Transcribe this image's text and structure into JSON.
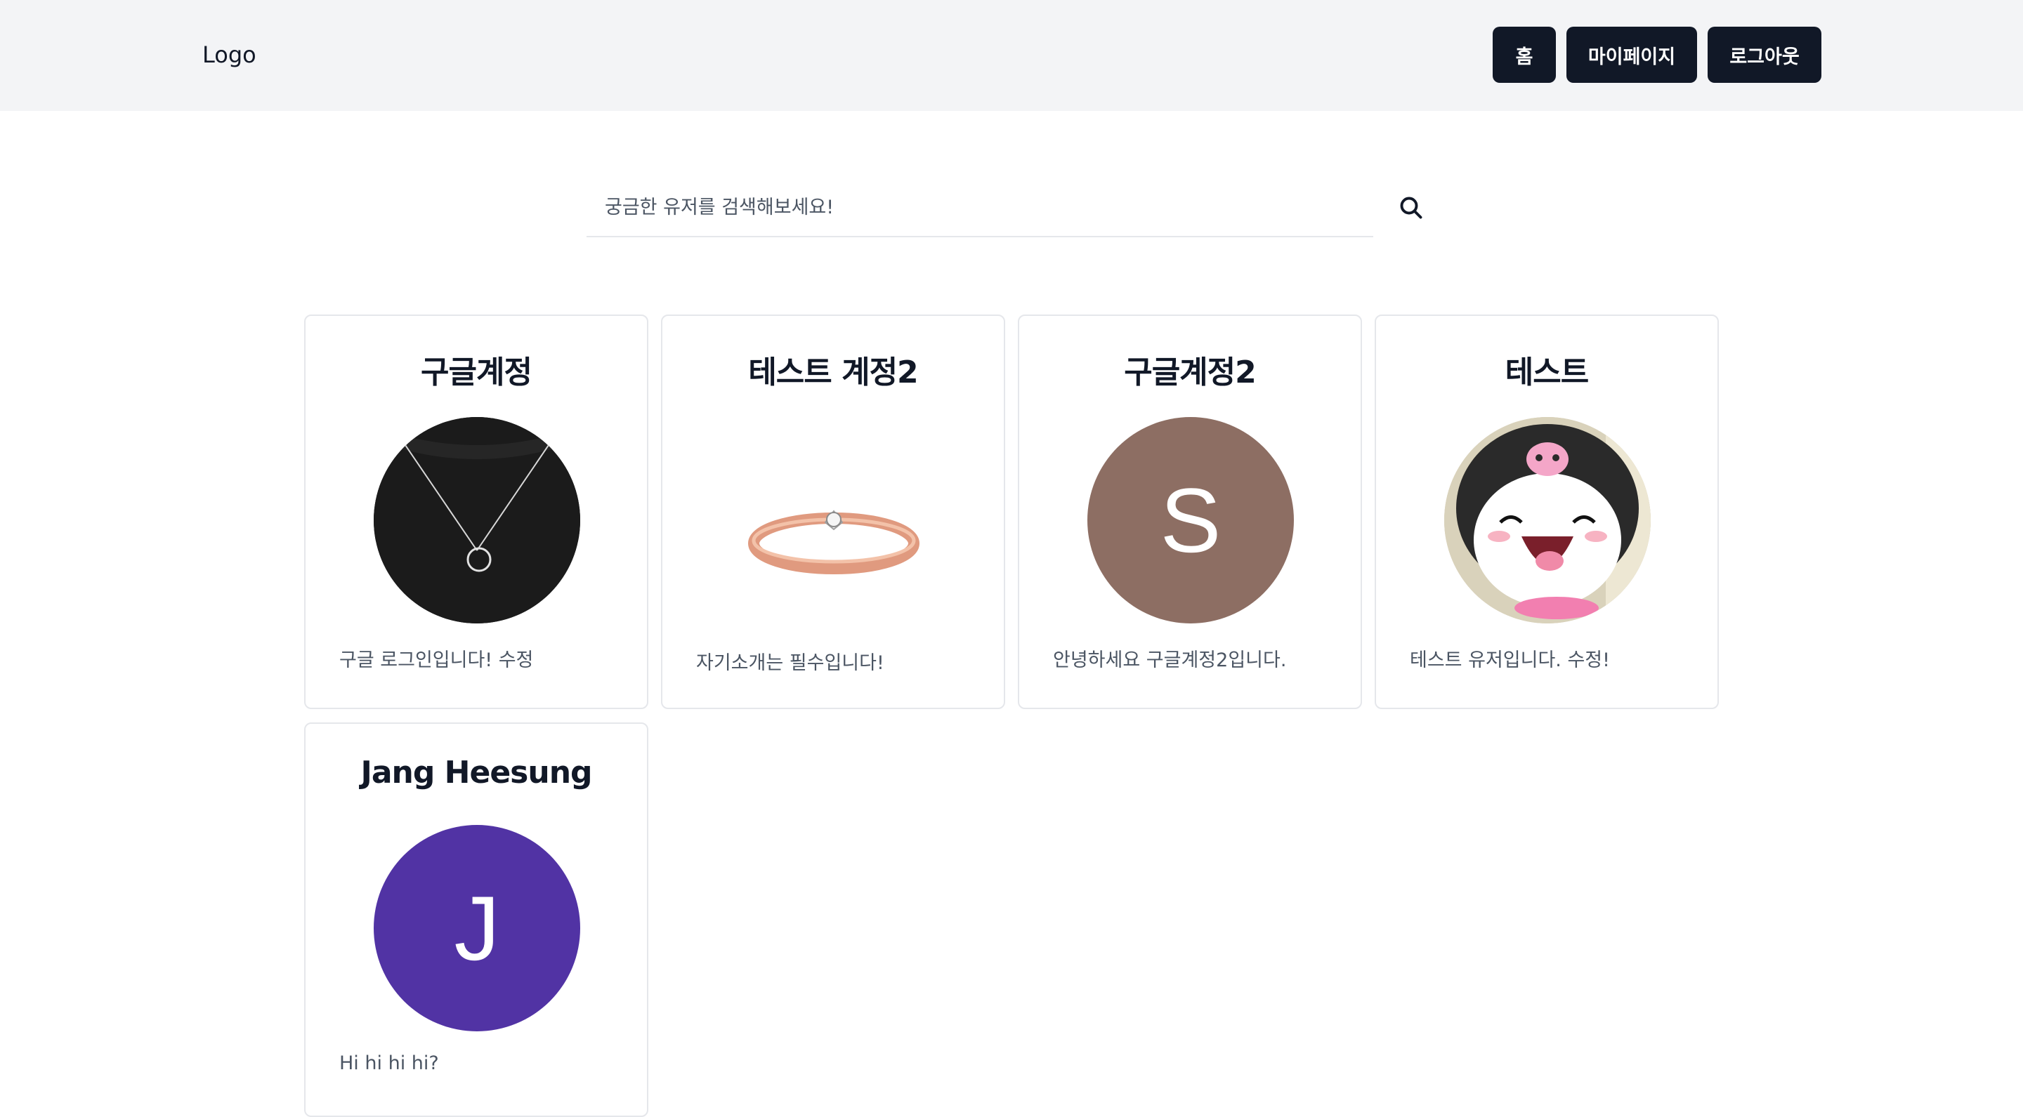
{
  "header": {
    "logo": "Logo",
    "nav": [
      {
        "label": "홈"
      },
      {
        "label": "마이페이지"
      },
      {
        "label": "로그아웃"
      }
    ]
  },
  "search": {
    "placeholder": "궁금한 유저를 검색해보세요!",
    "value": ""
  },
  "users": [
    {
      "name": "구글계정",
      "description": "구글 로그인입니다! 수정"
    },
    {
      "name": "테스트 계정2",
      "description": "자기소개는 필수입니다!"
    },
    {
      "name": "구글계정2",
      "description": "안녕하세요 구글계정2입니다.",
      "avatar_letter": "S",
      "avatar_color": "#8d6e63"
    },
    {
      "name": "테스트",
      "description": "테스트 유저입니다. 수정!"
    },
    {
      "name": "Jang Heesung",
      "description": "Hi hi hi hi?",
      "avatar_letter": "J",
      "avatar_color": "#5133a4"
    }
  ],
  "colors": {
    "header_bg": "#f3f4f6",
    "button_bg": "#111827",
    "border": "#e5e7eb"
  }
}
